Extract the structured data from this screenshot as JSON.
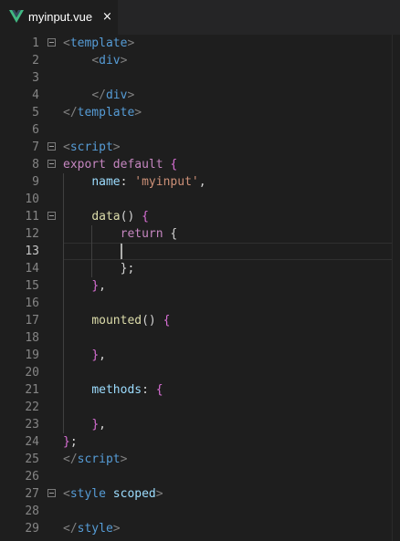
{
  "tab": {
    "label": "myinput.vue",
    "close": "×"
  },
  "colors": {
    "tag": "#808080",
    "tagname": "#569cd6",
    "keyword": "#c586c0",
    "prop": "#9cdcfe",
    "func": "#dcdcaa",
    "string": "#ce9178",
    "brace": "#da70d6",
    "text": "#d4d4d4"
  },
  "current_line": 13,
  "lines": [
    {
      "n": "1",
      "fold": true,
      "tokens": [
        [
          "tag",
          "<"
        ],
        [
          "tagname",
          "template"
        ],
        [
          "tag",
          ">"
        ]
      ]
    },
    {
      "n": "2",
      "fold": false,
      "tokens": [
        [
          "text",
          "    "
        ],
        [
          "tag",
          "<"
        ],
        [
          "tagname",
          "div"
        ],
        [
          "tag",
          ">"
        ]
      ]
    },
    {
      "n": "3",
      "fold": false,
      "tokens": []
    },
    {
      "n": "4",
      "fold": false,
      "tokens": [
        [
          "text",
          "    "
        ],
        [
          "tag",
          "</"
        ],
        [
          "tagname",
          "div"
        ],
        [
          "tag",
          ">"
        ]
      ]
    },
    {
      "n": "5",
      "fold": false,
      "tokens": [
        [
          "tag",
          "</"
        ],
        [
          "tagname",
          "template"
        ],
        [
          "tag",
          ">"
        ]
      ]
    },
    {
      "n": "6",
      "fold": false,
      "tokens": []
    },
    {
      "n": "7",
      "fold": true,
      "tokens": [
        [
          "tag",
          "<"
        ],
        [
          "tagname",
          "script"
        ],
        [
          "tag",
          ">"
        ]
      ]
    },
    {
      "n": "8",
      "fold": true,
      "tokens": [
        [
          "keyword",
          "export"
        ],
        [
          "text",
          " "
        ],
        [
          "keyword",
          "default"
        ],
        [
          "text",
          " "
        ],
        [
          "brace",
          "{"
        ]
      ]
    },
    {
      "n": "9",
      "fold": false,
      "tokens": [
        [
          "text",
          "    "
        ],
        [
          "prop",
          "name"
        ],
        [
          "text",
          ": "
        ],
        [
          "string",
          "'myinput'"
        ],
        [
          "text",
          ","
        ]
      ]
    },
    {
      "n": "10",
      "fold": false,
      "tokens": []
    },
    {
      "n": "11",
      "fold": true,
      "tokens": [
        [
          "text",
          "    "
        ],
        [
          "func",
          "data"
        ],
        [
          "text",
          "() "
        ],
        [
          "brace",
          "{"
        ]
      ]
    },
    {
      "n": "12",
      "fold": false,
      "tokens": [
        [
          "text",
          "        "
        ],
        [
          "keyword",
          "return"
        ],
        [
          "text",
          " {"
        ]
      ]
    },
    {
      "n": "13",
      "fold": false,
      "tokens": []
    },
    {
      "n": "14",
      "fold": false,
      "tokens": [
        [
          "text",
          "        };"
        ]
      ]
    },
    {
      "n": "15",
      "fold": false,
      "tokens": [
        [
          "text",
          "    "
        ],
        [
          "brace",
          "}"
        ],
        [
          "text",
          ","
        ]
      ]
    },
    {
      "n": "16",
      "fold": false,
      "tokens": []
    },
    {
      "n": "17",
      "fold": false,
      "tokens": [
        [
          "text",
          "    "
        ],
        [
          "func",
          "mounted"
        ],
        [
          "text",
          "() "
        ],
        [
          "brace",
          "{"
        ]
      ]
    },
    {
      "n": "18",
      "fold": false,
      "tokens": []
    },
    {
      "n": "19",
      "fold": false,
      "tokens": [
        [
          "text",
          "    "
        ],
        [
          "brace",
          "}"
        ],
        [
          "text",
          ","
        ]
      ]
    },
    {
      "n": "20",
      "fold": false,
      "tokens": []
    },
    {
      "n": "21",
      "fold": false,
      "tokens": [
        [
          "text",
          "    "
        ],
        [
          "prop",
          "methods"
        ],
        [
          "text",
          ": "
        ],
        [
          "brace",
          "{"
        ]
      ]
    },
    {
      "n": "22",
      "fold": false,
      "tokens": []
    },
    {
      "n": "23",
      "fold": false,
      "tokens": [
        [
          "text",
          "    "
        ],
        [
          "brace",
          "}"
        ],
        [
          "text",
          ","
        ]
      ]
    },
    {
      "n": "24",
      "fold": false,
      "tokens": [
        [
          "brace",
          "}"
        ],
        [
          "text",
          ";"
        ]
      ]
    },
    {
      "n": "25",
      "fold": false,
      "tokens": [
        [
          "tag",
          "</"
        ],
        [
          "tagname",
          "script"
        ],
        [
          "tag",
          ">"
        ]
      ]
    },
    {
      "n": "26",
      "fold": false,
      "tokens": []
    },
    {
      "n": "27",
      "fold": true,
      "tokens": [
        [
          "tag",
          "<"
        ],
        [
          "tagname",
          "style"
        ],
        [
          "text",
          " "
        ],
        [
          "prop",
          "scoped"
        ],
        [
          "tag",
          ">"
        ]
      ]
    },
    {
      "n": "28",
      "fold": false,
      "tokens": []
    },
    {
      "n": "29",
      "fold": false,
      "tokens": [
        [
          "tag",
          "</"
        ],
        [
          "tagname",
          "style"
        ],
        [
          "tag",
          ">"
        ]
      ]
    }
  ]
}
